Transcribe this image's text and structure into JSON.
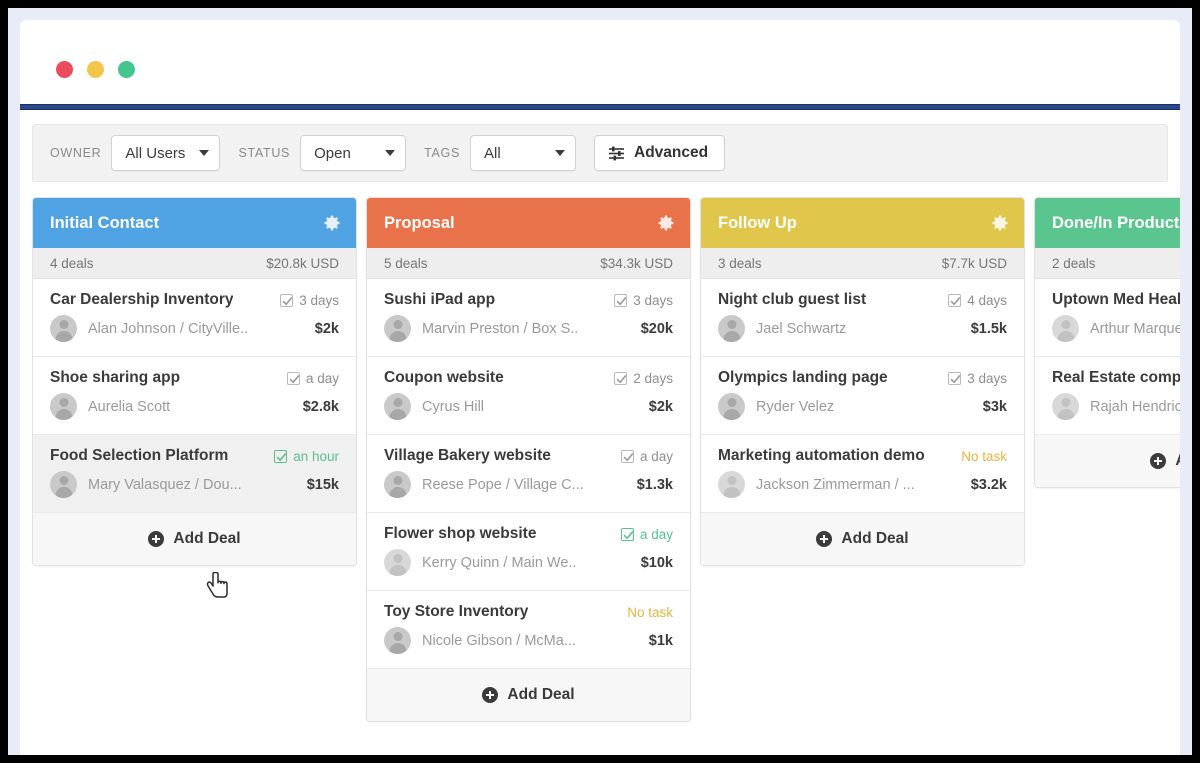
{
  "window": {
    "traffic_lights": [
      "close-red",
      "minimize-yellow",
      "maximize-green"
    ]
  },
  "toolbar": {
    "owner_label": "OWNER",
    "owner_value": "All Users",
    "status_label": "STATUS",
    "status_value": "Open",
    "tags_label": "TAGS",
    "tags_value": "All",
    "advanced_label": "Advanced",
    "advanced_icon": "sliders-icon"
  },
  "board": {
    "add_deal_label": "Add Deal",
    "columns": [
      {
        "title": "Initial Contact",
        "color": "#4fa3e3",
        "deals_count": "4 deals",
        "total": "$20.8k USD",
        "settings_icon": "gear-icon",
        "cards": [
          {
            "title": "Car Dealership Inventory",
            "due": "3 days",
            "due_state": "normal",
            "person": "Alan Johnson / CityVille..",
            "amount": "$2k",
            "hovered": false,
            "avatar_light": false
          },
          {
            "title": "Shoe sharing app",
            "due": "a day",
            "due_state": "normal",
            "person": "Aurelia Scott",
            "amount": "$2.8k",
            "hovered": false,
            "avatar_light": false
          },
          {
            "title": "Food Selection Platform",
            "due": "an hour",
            "due_state": "green",
            "person": "Mary Valasquez / Dou...",
            "amount": "$15k",
            "hovered": true,
            "avatar_light": false
          }
        ]
      },
      {
        "title": "Proposal",
        "color": "#e8734a",
        "deals_count": "5 deals",
        "total": "$34.3k USD",
        "settings_icon": "gear-icon",
        "cards": [
          {
            "title": "Sushi iPad app",
            "due": "3 days",
            "due_state": "normal",
            "person": "Marvin Preston / Box S..",
            "amount": "$20k",
            "hovered": false,
            "avatar_light": false
          },
          {
            "title": "Coupon website",
            "due": "2 days",
            "due_state": "normal",
            "person": "Cyrus Hill",
            "amount": "$2k",
            "hovered": false,
            "avatar_light": false
          },
          {
            "title": "Village Bakery website",
            "due": "a day",
            "due_state": "normal",
            "person": "Reese Pope / Village C...",
            "amount": "$1.3k",
            "hovered": false,
            "avatar_light": false
          },
          {
            "title": "Flower shop website",
            "due": "a day",
            "due_state": "green",
            "person": "Kerry Quinn / Main We..",
            "amount": "$10k",
            "hovered": false,
            "avatar_light": true
          },
          {
            "title": "Toy Store Inventory",
            "due": "No task",
            "due_state": "notask",
            "person": "Nicole Gibson / McMa...",
            "amount": "$1k",
            "hovered": false,
            "avatar_light": false
          }
        ]
      },
      {
        "title": "Follow Up",
        "color": "#e0c64b",
        "deals_count": "3 deals",
        "total": "$7.7k USD",
        "settings_icon": "gear-icon",
        "cards": [
          {
            "title": "Night club guest list",
            "due": "4 days",
            "due_state": "normal",
            "person": "Jael Schwartz",
            "amount": "$1.5k",
            "hovered": false,
            "avatar_light": false
          },
          {
            "title": "Olympics landing page",
            "due": "3 days",
            "due_state": "normal",
            "person": "Ryder Velez",
            "amount": "$3k",
            "hovered": false,
            "avatar_light": false
          },
          {
            "title": "Marketing automation demo",
            "due": "No task",
            "due_state": "notask",
            "person": "Jackson Zimmerman / ...",
            "amount": "$3.2k",
            "hovered": false,
            "avatar_light": true
          }
        ]
      },
      {
        "title": "Done/In Production",
        "color": "#5ac58e",
        "deals_count": "2 deals",
        "total": "",
        "settings_icon": "gear-icon",
        "cards": [
          {
            "title": "Uptown Med Health",
            "due": "",
            "due_state": "normal",
            "person": "Arthur Marquez",
            "amount": "",
            "hovered": false,
            "avatar_light": true
          },
          {
            "title": "Real Estate company",
            "due": "",
            "due_state": "normal",
            "person": "Rajah Hendricks",
            "amount": "",
            "hovered": false,
            "avatar_light": true
          }
        ]
      }
    ]
  }
}
